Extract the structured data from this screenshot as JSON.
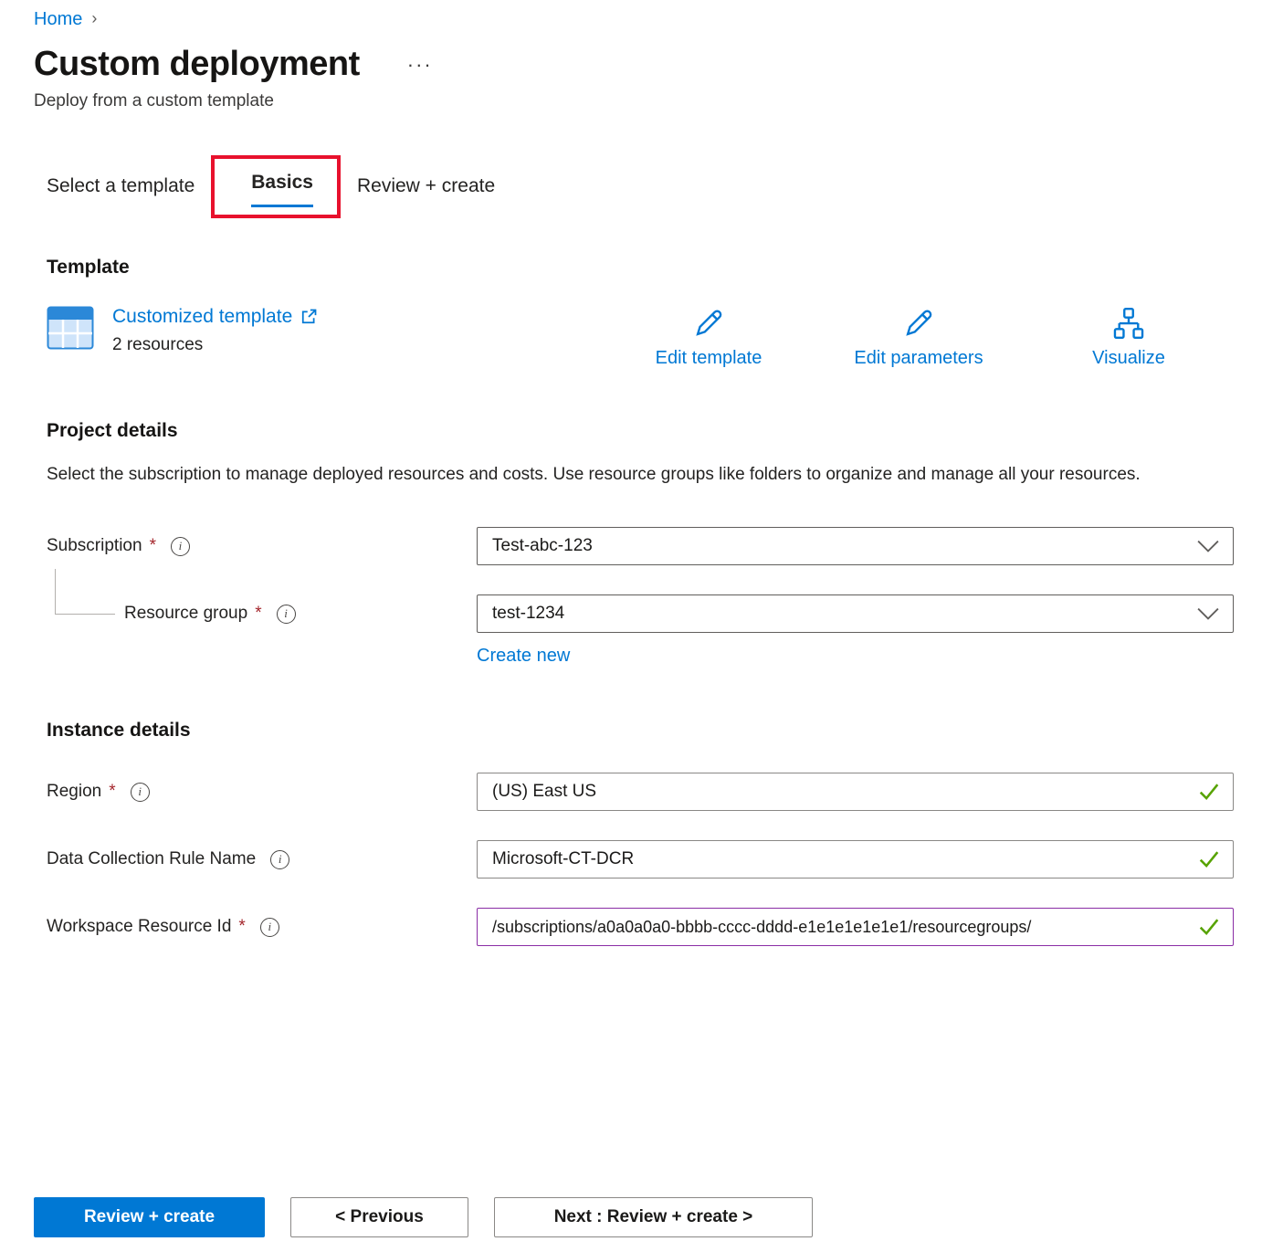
{
  "breadcrumb": {
    "home": "Home"
  },
  "header": {
    "title": "Custom deployment",
    "subtitle": "Deploy from a custom template"
  },
  "icons": {
    "chevron_right": "›",
    "ellipsis": "···",
    "info": "i"
  },
  "marks": {
    "required": "*"
  },
  "tabs": [
    {
      "label": "Select a template",
      "active": false
    },
    {
      "label": "Basics",
      "active": true
    },
    {
      "label": "Review + create",
      "active": false
    }
  ],
  "template_section": {
    "heading": "Template",
    "link_label": "Customized template",
    "resources_text": "2 resources",
    "actions": [
      {
        "label": "Edit template",
        "icon": "pencil-icon"
      },
      {
        "label": "Edit parameters",
        "icon": "pencil-icon"
      },
      {
        "label": "Visualize",
        "icon": "hierarchy-icon"
      }
    ]
  },
  "project_details": {
    "heading": "Project details",
    "description": "Select the subscription to manage deployed resources and costs. Use resource groups like folders to organize and manage all your resources.",
    "subscription": {
      "label": "Subscription",
      "value": "Test-abc-123"
    },
    "resource_group": {
      "label": "Resource group",
      "value": "test-1234",
      "create_new_label": "Create new"
    }
  },
  "instance_details": {
    "heading": "Instance details",
    "region": {
      "label": "Region",
      "value": "(US) East US"
    },
    "dcr_name": {
      "label": "Data Collection Rule Name",
      "value": "Microsoft-CT-DCR"
    },
    "workspace_id": {
      "label": "Workspace Resource Id",
      "value": "/subscriptions/a0a0a0a0-bbbb-cccc-dddd-e1e1e1e1e1e1/resourcegroups/"
    }
  },
  "footer": {
    "review_create_label": "Review + create",
    "previous_label": "< Previous",
    "next_label": "Next : Review + create >"
  },
  "colors": {
    "accent": "#0078d4",
    "required": "#a4262c",
    "valid_check": "#57a300",
    "highlight_box": "#e8112d",
    "edited_border": "#8a2da5"
  }
}
